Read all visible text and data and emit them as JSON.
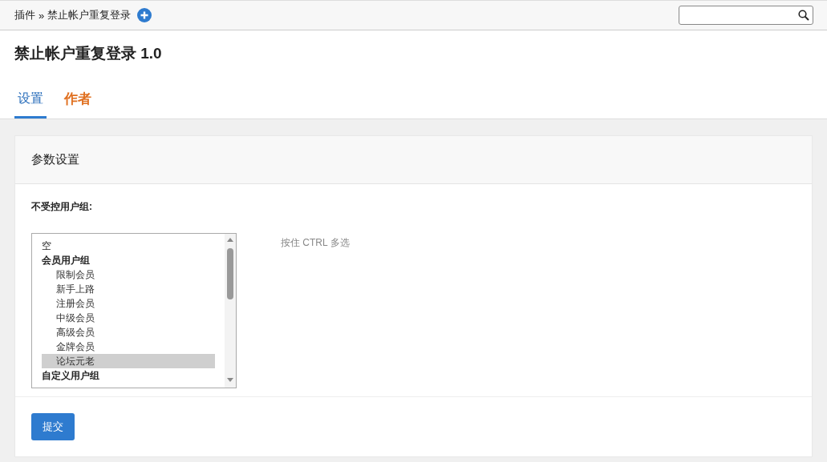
{
  "breadcrumb": {
    "items": [
      "插件",
      "禁止帐户重复登录"
    ],
    "separator": "»"
  },
  "page_title": "禁止帐户重复登录 1.0",
  "tabs": [
    {
      "label": "设置",
      "selected": true,
      "kind": "normal"
    },
    {
      "label": "作者",
      "selected": false,
      "kind": "highlight"
    }
  ],
  "panel": {
    "title": "参数设置",
    "field_label": "不受控用户组:",
    "hint": "按住 CTRL 多选",
    "options": [
      {
        "label": "空",
        "kind": "option",
        "selected": false
      },
      {
        "label": "会员用户组",
        "kind": "group",
        "selected": false
      },
      {
        "label": "限制会员",
        "kind": "child",
        "selected": false
      },
      {
        "label": "新手上路",
        "kind": "child",
        "selected": false
      },
      {
        "label": "注册会员",
        "kind": "child",
        "selected": false
      },
      {
        "label": "中级会员",
        "kind": "child",
        "selected": false
      },
      {
        "label": "高级会员",
        "kind": "child",
        "selected": false
      },
      {
        "label": "金牌会员",
        "kind": "child",
        "selected": false
      },
      {
        "label": "论坛元老",
        "kind": "child",
        "selected": true
      },
      {
        "label": "自定义用户组",
        "kind": "group",
        "selected": false
      }
    ]
  },
  "submit_button": "提交"
}
